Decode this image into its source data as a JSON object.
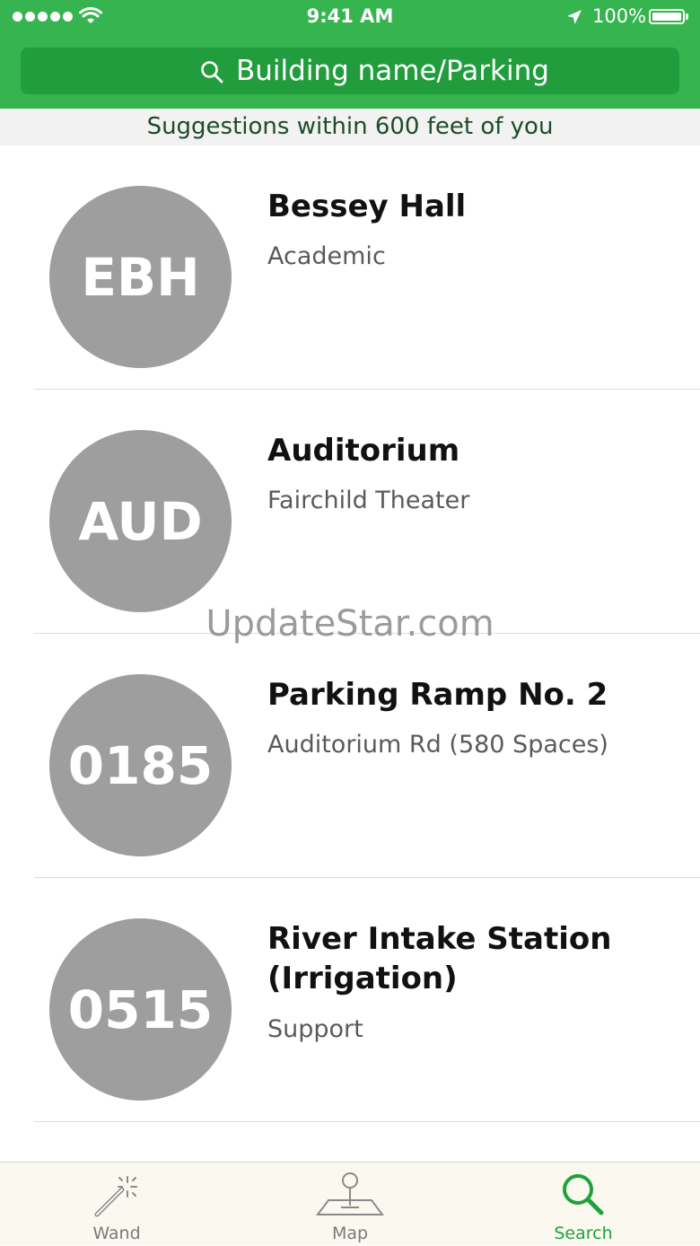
{
  "status_bar": {
    "time": "9:41 AM",
    "battery": "100%"
  },
  "search": {
    "placeholder": "Building name/Parking"
  },
  "suggestions_banner": "Suggestions within 600 feet of you",
  "results": [
    {
      "code": "EBH",
      "name": "Bessey Hall",
      "detail": "Academic"
    },
    {
      "code": "AUD",
      "name": "Auditorium",
      "detail": "Fairchild Theater"
    },
    {
      "code": "0185",
      "name": "Parking Ramp No. 2",
      "detail": "Auditorium Rd (580 Spaces)"
    },
    {
      "code": "0515",
      "name": "River Intake Station (Irrigation)",
      "detail": "Support"
    }
  ],
  "watermark": "UpdateStar.com",
  "tabs": [
    {
      "label": "Wand",
      "icon": "wand-icon"
    },
    {
      "label": "Map",
      "icon": "map-pin-icon"
    },
    {
      "label": "Search",
      "icon": "search-icon",
      "active": true
    }
  ],
  "colors": {
    "header": "#35b44f",
    "search_field": "#219d3e",
    "circle": "#9e9e9e",
    "active_tab": "#1fa23b"
  }
}
